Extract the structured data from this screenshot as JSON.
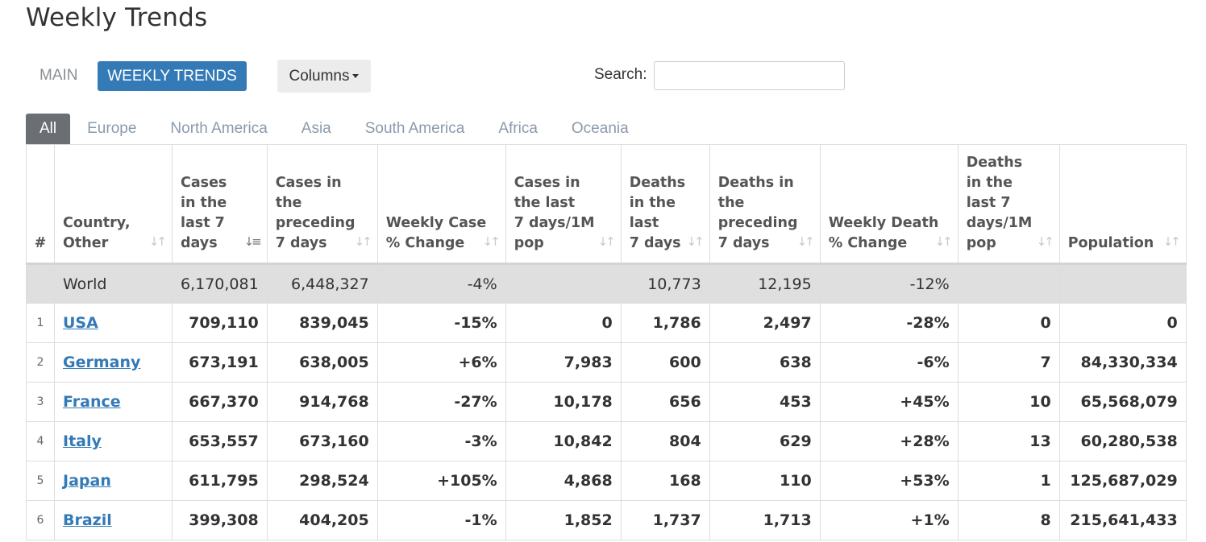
{
  "page": {
    "title": "Weekly Trends"
  },
  "nav": {
    "main_label": "MAIN",
    "weekly_label": "WEEKLY TRENDS",
    "columns_label": "Columns"
  },
  "search": {
    "label": "Search:",
    "value": ""
  },
  "region_tabs": [
    "All",
    "Europe",
    "North America",
    "Asia",
    "South America",
    "Africa",
    "Oceania"
  ],
  "table": {
    "headers": {
      "rank": "#",
      "country": [
        "Country,",
        "Other"
      ],
      "cases_7": [
        "Cases",
        "in the",
        "last 7",
        "days"
      ],
      "cases_prev": [
        "Cases in",
        "the",
        "preceding",
        "7 days"
      ],
      "weekly_case_change": [
        "Weekly Case",
        "% Change"
      ],
      "cases_per_m": [
        "Cases in",
        "the last",
        "7 days/1M",
        "pop"
      ],
      "deaths_7": [
        "Deaths",
        "in the",
        "last",
        "7 days"
      ],
      "deaths_prev": [
        "Deaths in",
        "the",
        "preceding",
        "7 days"
      ],
      "weekly_death_change": [
        "Weekly Death",
        "% Change"
      ],
      "deaths_per_m": [
        "Deaths",
        "in the",
        "last 7",
        "days/1M",
        "pop"
      ],
      "population": [
        "Population"
      ]
    },
    "world": {
      "country": "World",
      "cases_7": "6,170,081",
      "cases_prev": "6,448,327",
      "case_change": "-4%",
      "cases_per_m": "",
      "deaths_7": "10,773",
      "deaths_prev": "12,195",
      "death_change": "-12%",
      "deaths_per_m": "",
      "population": ""
    },
    "rows": [
      {
        "rank": "1",
        "country": "USA",
        "cases_7": "709,110",
        "cases_prev": "839,045",
        "case_change": "-15%",
        "cases_per_m": "0",
        "deaths_7": "1,786",
        "deaths_prev": "2,497",
        "death_change": "-28%",
        "deaths_per_m": "0",
        "population": "0"
      },
      {
        "rank": "2",
        "country": "Germany",
        "cases_7": "673,191",
        "cases_prev": "638,005",
        "case_change": "+6%",
        "cases_per_m": "7,983",
        "deaths_7": "600",
        "deaths_prev": "638",
        "death_change": "-6%",
        "deaths_per_m": "7",
        "population": "84,330,334"
      },
      {
        "rank": "3",
        "country": "France",
        "cases_7": "667,370",
        "cases_prev": "914,768",
        "case_change": "-27%",
        "cases_per_m": "10,178",
        "deaths_7": "656",
        "deaths_prev": "453",
        "death_change": "+45%",
        "deaths_per_m": "10",
        "population": "65,568,079"
      },
      {
        "rank": "4",
        "country": "Italy",
        "cases_7": "653,557",
        "cases_prev": "673,160",
        "case_change": "-3%",
        "cases_per_m": "10,842",
        "deaths_7": "804",
        "deaths_prev": "629",
        "death_change": "+28%",
        "deaths_per_m": "13",
        "population": "60,280,538"
      },
      {
        "rank": "5",
        "country": "Japan",
        "cases_7": "611,795",
        "cases_prev": "298,524",
        "case_change": "+105%",
        "cases_per_m": "4,868",
        "deaths_7": "168",
        "deaths_prev": "110",
        "death_change": "+53%",
        "deaths_per_m": "1",
        "population": "125,687,029"
      },
      {
        "rank": "6",
        "country": "Brazil",
        "cases_7": "399,308",
        "cases_prev": "404,205",
        "case_change": "-1%",
        "cases_per_m": "1,852",
        "deaths_7": "1,737",
        "deaths_prev": "1,713",
        "death_change": "+1%",
        "deaths_per_m": "8",
        "population": "215,641,433"
      }
    ]
  },
  "colors": {
    "accent": "#337ab7",
    "active_tab": "#6b6f74",
    "world_row": "#dfdfdf"
  }
}
